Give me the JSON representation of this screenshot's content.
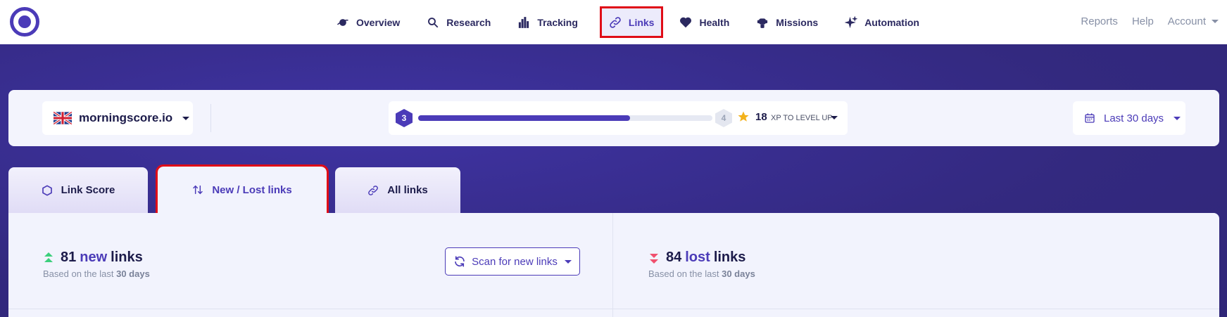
{
  "nav": {
    "items": [
      {
        "id": "overview",
        "label": "Overview",
        "icon": "planet-icon"
      },
      {
        "id": "research",
        "label": "Research",
        "icon": "search-icon"
      },
      {
        "id": "tracking",
        "label": "Tracking",
        "icon": "bar-chart-icon"
      },
      {
        "id": "links",
        "label": "Links",
        "icon": "link-icon",
        "active": true
      },
      {
        "id": "health",
        "label": "Health",
        "icon": "heart-icon"
      },
      {
        "id": "missions",
        "label": "Missions",
        "icon": "robot-icon"
      },
      {
        "id": "automation",
        "label": "Automation",
        "icon": "sparkle-icon"
      }
    ],
    "right": {
      "reports": "Reports",
      "help": "Help",
      "account": "Account"
    }
  },
  "controls": {
    "site": "morningscore.io",
    "level_current": "3",
    "level_next": "4",
    "xp_progress": 0.72,
    "xp_value": "18",
    "xp_label": "XP TO LEVEL UP",
    "date_range": "Last 30 days"
  },
  "tabs": [
    {
      "id": "link-score",
      "label": "Link Score"
    },
    {
      "id": "new-lost",
      "label": "New / Lost links",
      "active": true
    },
    {
      "id": "all-links",
      "label": "All links"
    }
  ],
  "stats": {
    "new": {
      "count": "81",
      "kind": "new",
      "suffix": "links",
      "sub_prefix": "Based on the last",
      "sub_value": "30 days"
    },
    "lost": {
      "count": "84",
      "kind": "lost",
      "suffix": "links",
      "sub_prefix": "Based on the last",
      "sub_value": "30 days"
    },
    "scan_button": "Scan for new links"
  },
  "colors": {
    "accent": "#4b3bb8",
    "dark_text": "#1c1b4a",
    "band": "#33297f",
    "highlight_box": "#e00d17",
    "up_arrow": "#3ccf7c",
    "down_arrow": "#f0506e",
    "star": "#f3b21b"
  }
}
